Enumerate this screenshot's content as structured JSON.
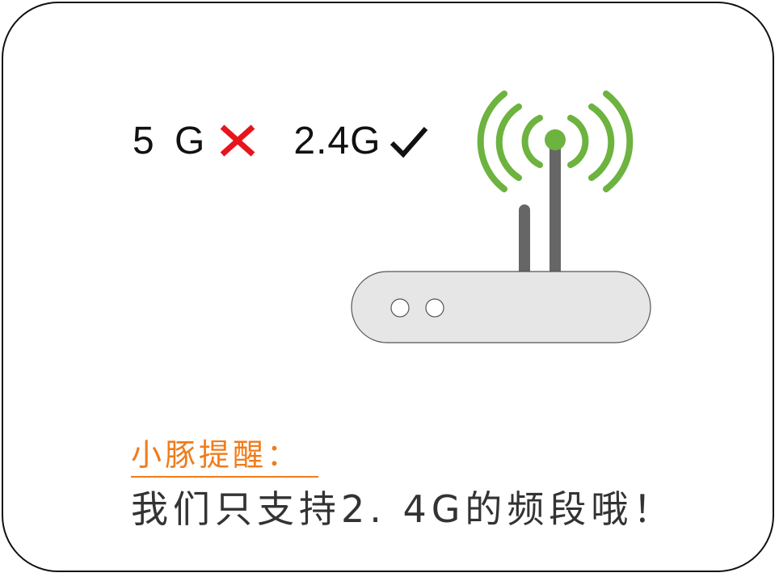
{
  "bands": {
    "unsupported": {
      "label": "5 G",
      "mark": "cross-icon"
    },
    "supported": {
      "label": "2.4G",
      "mark": "check-icon"
    }
  },
  "router": {
    "icon": "wifi-router-icon",
    "signal_color": "#6db33f",
    "antenna_color": "#666666",
    "body_color": "#e6e6e6"
  },
  "tip": {
    "title": "小豚提醒：",
    "message": "我们只支持2. 4G的频段哦！"
  },
  "colors": {
    "cross": "#e8141c",
    "check": "#111111",
    "title": "#f07c1c",
    "text": "#333333"
  }
}
